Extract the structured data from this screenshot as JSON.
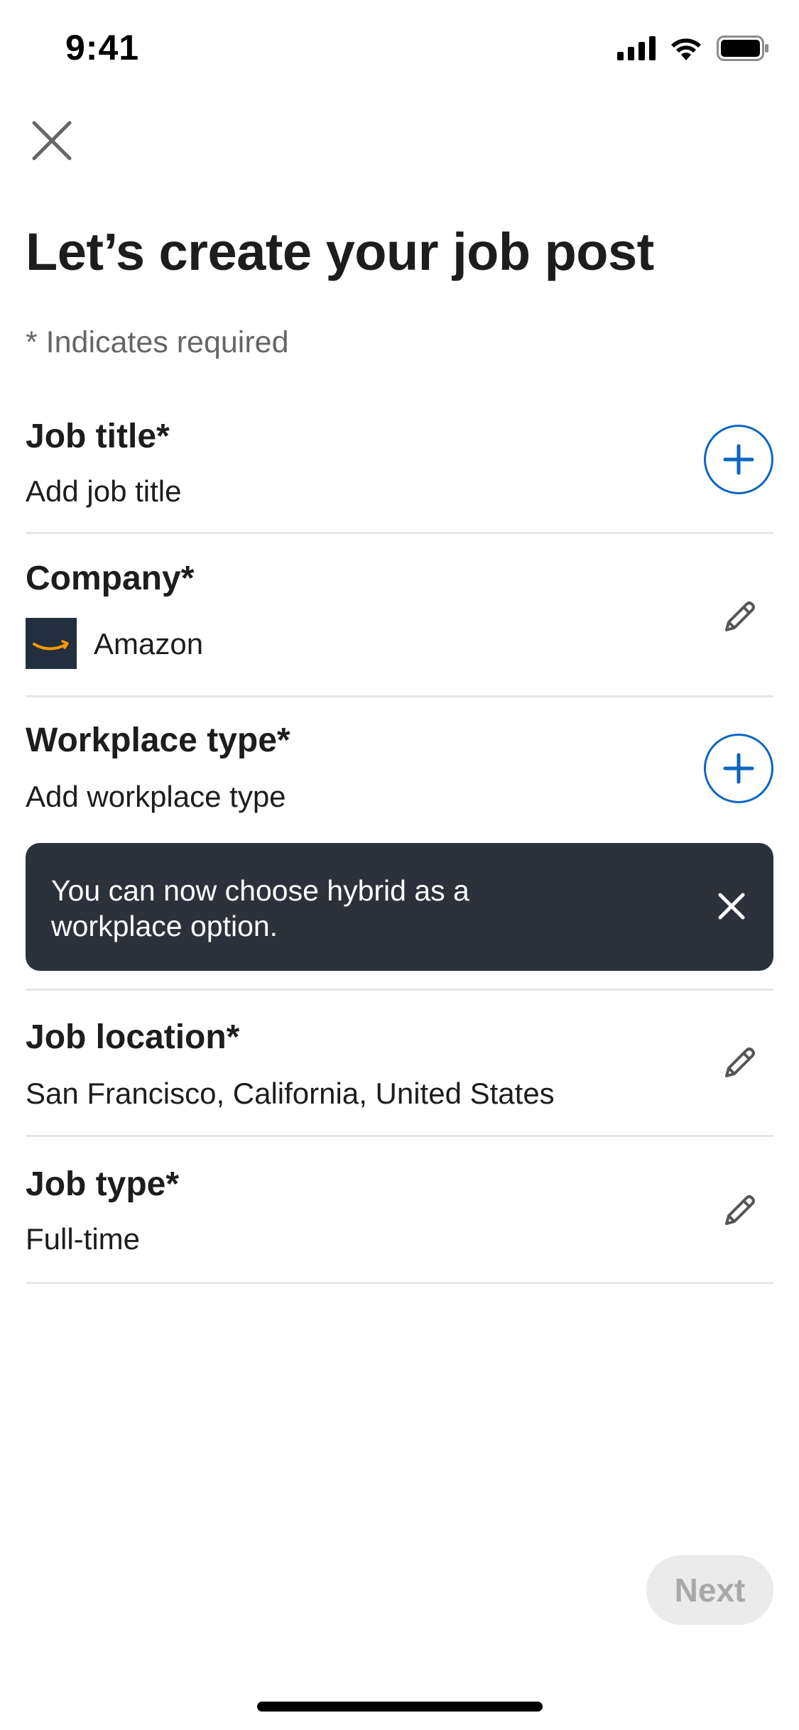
{
  "status_bar": {
    "time": "9:41"
  },
  "title": "Let’s create your job post",
  "required_note": "* Indicates required",
  "fields": {
    "job_title": {
      "label": "Job title*",
      "value": "Add job title"
    },
    "company": {
      "label": "Company*",
      "value": "Amazon"
    },
    "workplace_type": {
      "label": "Workplace type*",
      "value": "Add workplace type"
    },
    "job_location": {
      "label": "Job location*",
      "value": "San Francisco, California, United States"
    },
    "job_type": {
      "label": "Job type*",
      "value": "Full-time"
    }
  },
  "toast": {
    "message": "You can now choose hybrid as a workplace option."
  },
  "next_button": "Next",
  "colors": {
    "accent": "#0a66c2",
    "toast_bg": "#2b323c",
    "amazon_bg": "#232f3e",
    "amazon_smile": "#ff9900"
  },
  "icons": [
    "signal-icon",
    "wifi-icon",
    "battery-icon",
    "close-icon",
    "plus-icon",
    "pencil-icon"
  ]
}
